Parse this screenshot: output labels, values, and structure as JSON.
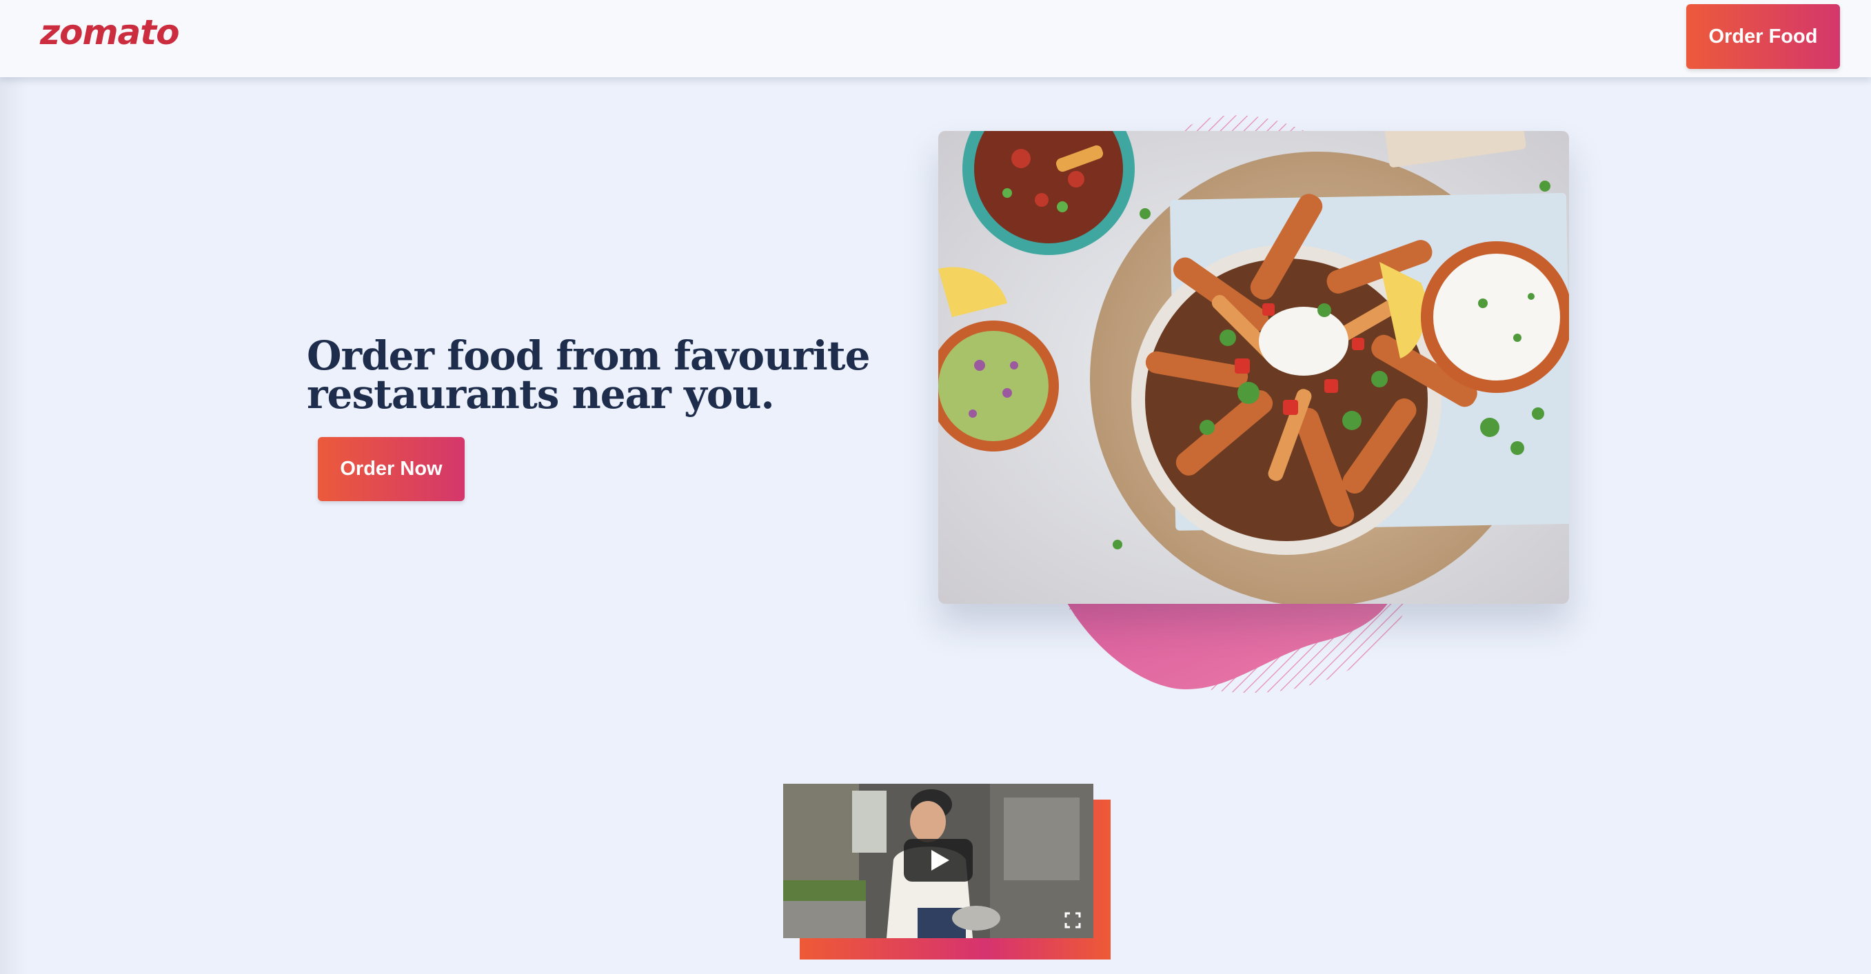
{
  "header": {
    "logo": "zomato",
    "order_food_label": "Order Food"
  },
  "hero": {
    "headline_line1": "Order food from favourite",
    "headline_line2": "restaurants near you.",
    "cta_label": "Order Now",
    "image_alt": "food-platter-photo"
  },
  "video": {
    "thumbnail": "chef-cooking-video",
    "play_icon": "play-icon",
    "fullscreen_icon": "fullscreen-icon"
  },
  "colors": {
    "brand_red": "#cb2d3e",
    "gradient_start": "#ec5a3b",
    "gradient_end": "#d4376b",
    "background": "#ecf1fb",
    "headline": "#1f2d4d",
    "blob_pink": "#e272a3"
  }
}
